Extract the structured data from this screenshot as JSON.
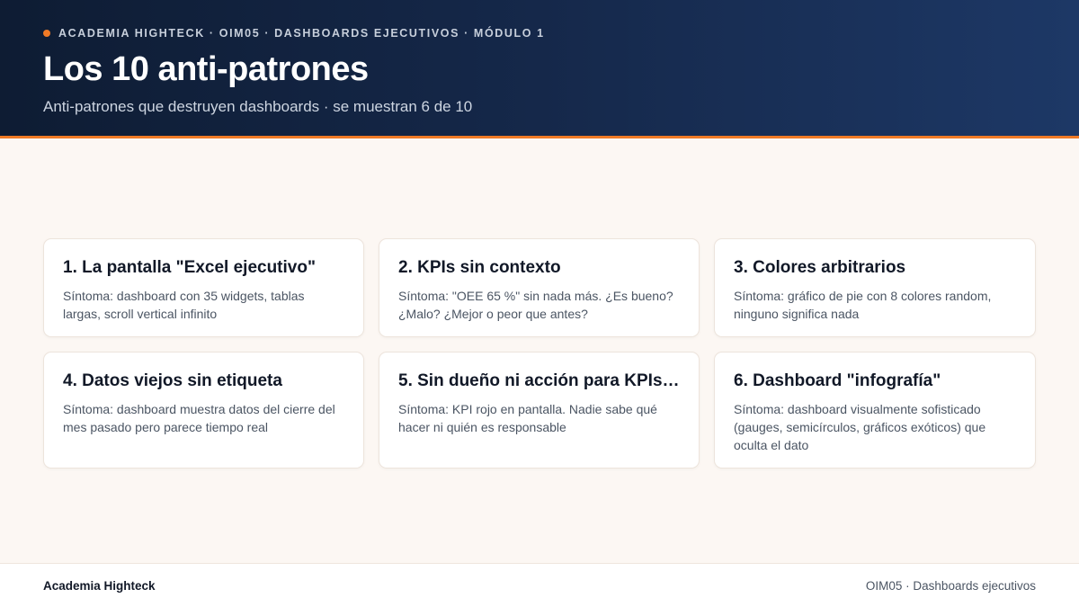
{
  "header": {
    "eyebrow": "ACADEMIA HIGHTECK · OIM05 · DASHBOARDS EJECUTIVOS · MÓDULO 1",
    "title": "Los 10 anti-patrones",
    "subtitle": "Anti-patrones que destruyen dashboards · se muestran 6 de 10"
  },
  "cards": [
    {
      "title": "1. La pantalla \"Excel ejecutivo\"",
      "text": "Síntoma: dashboard con 35 widgets, tablas largas, scroll vertical infinito"
    },
    {
      "title": "2. KPIs sin contexto",
      "text": "Síntoma: \"OEE 65 %\" sin nada más. ¿Es bueno? ¿Malo? ¿Mejor o peor que antes?"
    },
    {
      "title": "3. Colores arbitrarios",
      "text": "Síntoma: gráfico de pie con 8 colores random, ninguno significa nada"
    },
    {
      "title": "4. Datos viejos sin etiqueta",
      "text": "Síntoma: dashboard muestra datos del cierre del mes pasado pero parece tiempo real"
    },
    {
      "title": "5. Sin dueño ni acción para KPIs…",
      "text": "Síntoma: KPI rojo en pantalla. Nadie sabe qué hacer ni quién es responsable"
    },
    {
      "title": "6. Dashboard \"infografía\"",
      "text": "Síntoma: dashboard visualmente sofisticado (gauges, semicírculos, gráficos exóticos) que oculta el dato"
    }
  ],
  "footer": {
    "left": "Academia Highteck",
    "right": "OIM05 · Dashboards ejecutivos"
  },
  "colors": {
    "accent": "#f07a26",
    "header_dark": "#0e1c33",
    "header_light": "#1d3866",
    "background": "#fcf7f3"
  }
}
